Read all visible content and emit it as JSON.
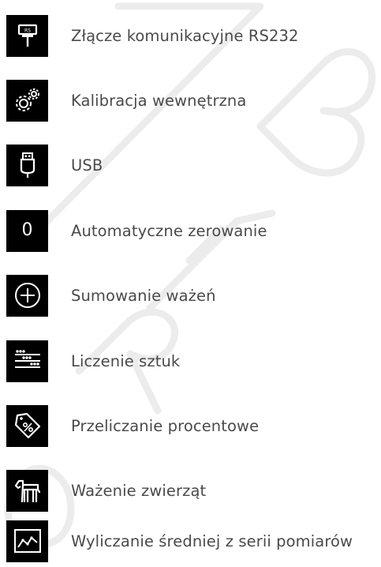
{
  "accent_color": "#000000",
  "text_color": "#4a4a4a",
  "features": [
    {
      "icon": "rs232-connector-icon",
      "label": "Złącze komunikacyjne RS232"
    },
    {
      "icon": "gears-icon",
      "label": "Kalibracja wewnętrzna"
    },
    {
      "icon": "usb-icon",
      "label": "USB"
    },
    {
      "icon": "zero-icon",
      "glyph": "0",
      "label": "Automatyczne zerowanie"
    },
    {
      "icon": "plus-circle-icon",
      "label": "Sumowanie ważeń"
    },
    {
      "icon": "counting-icon",
      "label": "Liczenie sztuk"
    },
    {
      "icon": "percent-tag-icon",
      "label": "Przeliczanie procentowe"
    },
    {
      "icon": "animal-icon",
      "label": "Ważenie zwierząt"
    },
    {
      "icon": "chart-average-icon",
      "label": "Wyliczanie średniej z serii pomiarów"
    }
  ]
}
